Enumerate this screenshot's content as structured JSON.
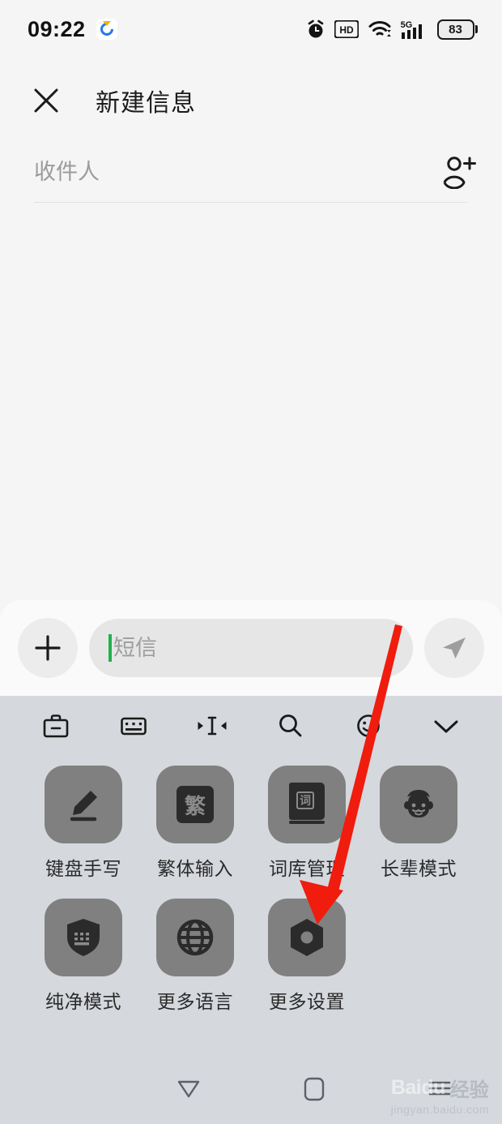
{
  "status_bar": {
    "time": "09:22",
    "weather_icon": "weather-app-icon",
    "icons": [
      "alarm-icon",
      "hd-icon",
      "wifi-icon",
      "5g-signal-icon"
    ],
    "hd_label": "HD",
    "network_label": "5G",
    "battery_level": "83"
  },
  "header": {
    "close_icon": "close-icon",
    "title": "新建信息"
  },
  "recipient": {
    "placeholder": "收件人",
    "value": "",
    "add_contact_icon": "add-contact-icon"
  },
  "compose": {
    "plus_icon": "plus-icon",
    "sms_placeholder": "短信",
    "sms_value": "",
    "send_icon": "send-icon",
    "caret_color": "#22b14c"
  },
  "keyboard": {
    "toolbar": [
      {
        "name": "toolbox-icon",
        "label": "工具箱"
      },
      {
        "name": "keyboard-icon",
        "label": "键盘"
      },
      {
        "name": "cursor-move-icon",
        "label": "移动光标"
      },
      {
        "name": "search-icon",
        "label": "搜索"
      },
      {
        "name": "emoji-icon",
        "label": "表情"
      },
      {
        "name": "chevron-down-icon",
        "label": "收起"
      }
    ],
    "tiles": [
      {
        "label": "键盘手写",
        "icon": "pencil-icon"
      },
      {
        "label": "繁体输入",
        "icon": "traditional-chinese-icon",
        "glyph": "繁"
      },
      {
        "label": "词库管理",
        "icon": "dictionary-book-icon",
        "glyph": "词"
      },
      {
        "label": "长辈模式",
        "icon": "elder-face-icon"
      },
      {
        "label": "纯净模式",
        "icon": "shield-keyboard-icon"
      },
      {
        "label": "更多语言",
        "icon": "globe-icon"
      },
      {
        "label": "更多设置",
        "icon": "gear-nut-icon"
      }
    ],
    "tile_color": "#808080",
    "panel_color": "#d5d8dd"
  },
  "bottom_nav": [
    {
      "name": "back-icon",
      "label": "返回"
    },
    {
      "name": "home-icon",
      "label": "主页"
    },
    {
      "name": "recents-menu-icon",
      "label": "菜单"
    }
  ],
  "watermark": {
    "brand": "Baidu",
    "suffix": "经验",
    "url": "jingyan.baidu.com"
  },
  "annotation": {
    "arrow_color": "#f01c0e",
    "points_to": "更多设置"
  }
}
